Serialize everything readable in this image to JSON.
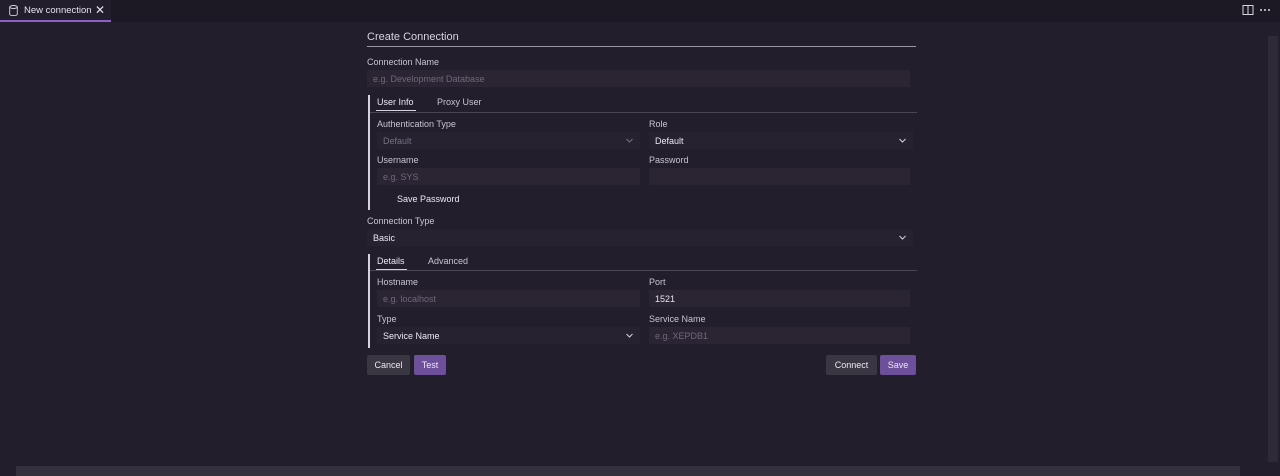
{
  "tabbar": {
    "tab_label": "New connection",
    "close_glyph": "✕",
    "icons": [
      "database-icon",
      "split-editor-icon",
      "more-actions-icon"
    ]
  },
  "form": {
    "title": "Create Connection",
    "connection_name": {
      "label": "Connection Name",
      "value": "",
      "placeholder": "e.g. Development Database"
    },
    "auth_group": {
      "tabs": [
        "User Info",
        "Proxy User"
      ],
      "active_tab": "User Info",
      "auth_type": {
        "label": "Authentication Type",
        "value": "Default"
      },
      "role": {
        "label": "Role",
        "value": "Default"
      },
      "username": {
        "label": "Username",
        "value": "",
        "placeholder": "e.g. SYS"
      },
      "password": {
        "label": "Password",
        "value": "",
        "placeholder": ""
      },
      "save_password": {
        "label": "Save Password",
        "checked": false
      }
    },
    "connection_type": {
      "label": "Connection Type",
      "value": "Basic"
    },
    "details_group": {
      "tabs": [
        "Details",
        "Advanced"
      ],
      "active_tab": "Details",
      "hostname": {
        "label": "Hostname",
        "value": "",
        "placeholder": "e.g. localhost"
      },
      "port": {
        "label": "Port",
        "value": "1521"
      },
      "type": {
        "label": "Type",
        "value": "Service Name"
      },
      "service_name": {
        "label": "Service Name",
        "value": "",
        "placeholder": "e.g. XEPDB1"
      }
    },
    "buttons": {
      "cancel": "Cancel",
      "test": "Test",
      "connect": "Connect",
      "save": "Save"
    }
  },
  "colors": {
    "background": "#231e2c",
    "input_background": "#2a2433",
    "accent": "#6d4f9c",
    "tab_accent": "#8e5fc9"
  }
}
